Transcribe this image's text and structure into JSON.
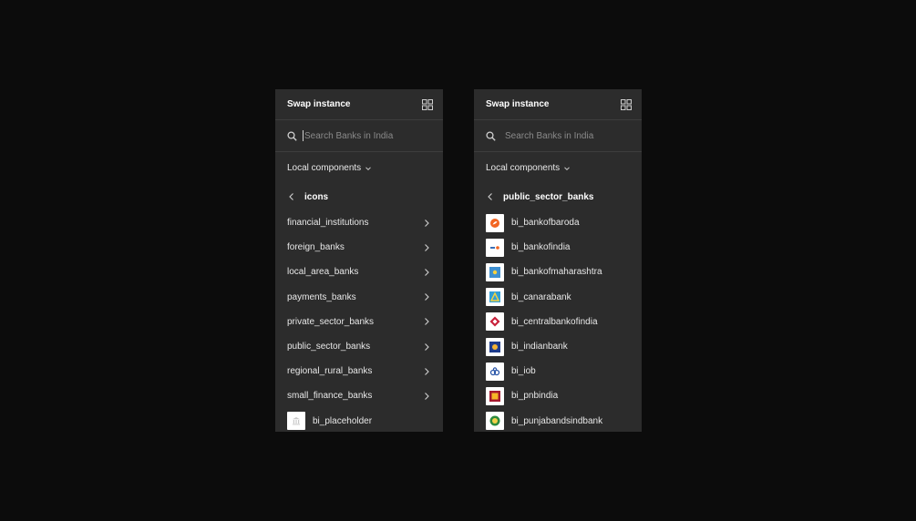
{
  "left_panel": {
    "title": "Swap instance",
    "search_placeholder": "Search Banks in India",
    "dropdown_label": "Local components",
    "back_label": "icons",
    "folders": [
      "financial_institutions",
      "foreign_banks",
      "local_area_banks",
      "payments_banks",
      "private_sector_banks",
      "public_sector_banks",
      "regional_rural_banks",
      "small_finance_banks"
    ],
    "component": "bi_placeholder"
  },
  "right_panel": {
    "title": "Swap instance",
    "search_placeholder": "Search Banks in India",
    "dropdown_label": "Local components",
    "back_label": "public_sector_banks",
    "components": [
      "bi_bankofbaroda",
      "bi_bankofindia",
      "bi_bankofmaharashtra",
      "bi_canarabank",
      "bi_centralbankofindia",
      "bi_indianbank",
      "bi_iob",
      "bi_pnbindia",
      "bi_punjabandsindbank"
    ]
  },
  "colors": {
    "background": "#0c0c0c",
    "panel": "#2c2c2c",
    "divider": "#3d3d3d",
    "text": "#e8e8e8",
    "placeholder": "#8a8a8a"
  }
}
